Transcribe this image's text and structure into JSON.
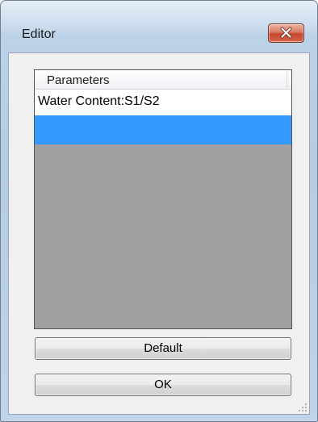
{
  "window": {
    "title": "Editor"
  },
  "titlebar": {
    "close_icon": "close-icon"
  },
  "list": {
    "header": "Parameters",
    "rows": [
      {
        "label": "Water Content:S1/S2",
        "selected": false
      },
      {
        "label": "",
        "selected": true
      }
    ]
  },
  "buttons": {
    "default_label": "Default",
    "ok_label": "OK"
  },
  "colors": {
    "selection": "#3399ff",
    "list_background": "#a0a0a0",
    "close_button": "#c5462b"
  }
}
